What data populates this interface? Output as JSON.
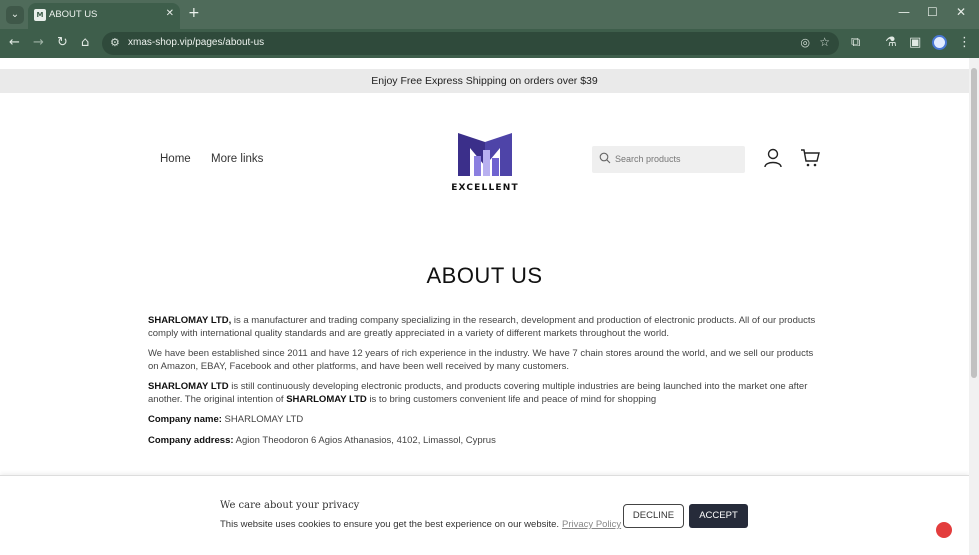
{
  "browser": {
    "tab_title": "ABOUT US",
    "new_tab": "+",
    "url": "xmas-shop.vip/pages/about-us",
    "window_controls": {
      "minimize": "—",
      "maximize": "☐",
      "close": "✕"
    },
    "icons": [
      "tab-search-icon",
      "back-icon",
      "forward-icon",
      "reload-icon",
      "home-icon",
      "site-info-icon",
      "eye-off-icon",
      "star-icon",
      "extensions-icon",
      "labs-icon",
      "sidebar-icon",
      "profile-icon",
      "kebab-menu-icon"
    ]
  },
  "announcement": "Enjoy Free Express Shipping on orders over $39",
  "nav": {
    "home": "Home",
    "more_links": "More links"
  },
  "logo": {
    "text": "EXCELLENT",
    "colors": {
      "dark": "#3b2f8a",
      "light": "#8b7fe0"
    }
  },
  "search": {
    "placeholder": "Search products"
  },
  "page": {
    "title": "ABOUT US",
    "p1_company": "SHARLOMAY LTD,",
    "p1_rest": " is a manufacturer and trading company specializing in the research, development and production of electronic products. All of our products comply with international quality standards and are greatly appreciated in a variety of different markets throughout the world.",
    "p2": "We have been established since 2011 and have 12 years of rich experience in the industry. We have 7 chain stores around the world, and we sell our products on Amazon, EBAY, Facebook and other platforms, and have been well received by many customers.",
    "p3_company": "SHARLOMAY LTD",
    "p3_mid": " is still continuously developing electronic products, and products covering multiple industries are being launched into the market one after another. The original intention of ",
    "p3_company2": "SHARLOMAY LTD",
    "p3_end": " is to bring customers convenient life and peace of mind for shopping",
    "company_name_label": "Company name:",
    "company_name_value": "SHARLOMAY LTD",
    "company_address_label": "Company address:",
    "company_address_value": "Agion Theodoron 6 Agios Athanasios, 4102, Limassol, Cyprus"
  },
  "cookie": {
    "title": "We care about your privacy",
    "text": "This website uses cookies to ensure you get the best experience on our website.",
    "link": "Privacy Policy",
    "decline": "DECLINE",
    "accept": "ACCEPT"
  },
  "colors": {
    "chrome_frame": "#4f6b5a",
    "chrome_toolbar": "#3e5e4b",
    "accept_button": "#262b3a",
    "announcement_bg": "#eaeaea"
  }
}
